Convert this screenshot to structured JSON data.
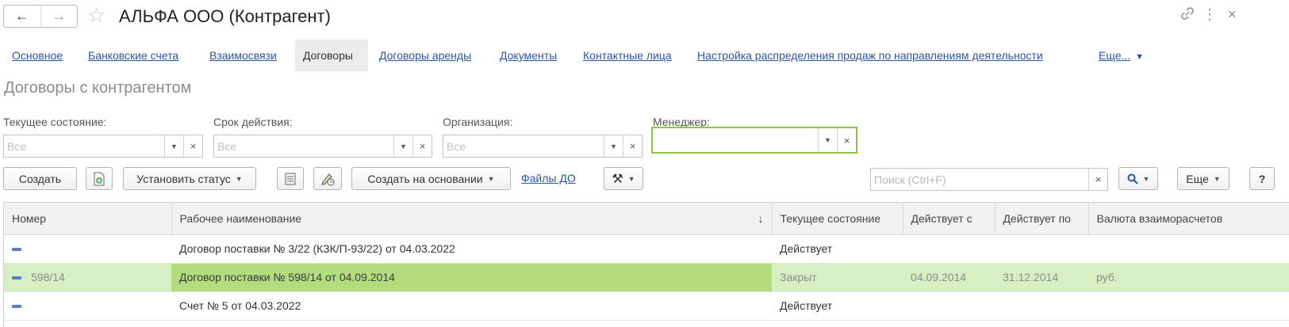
{
  "window": {
    "title": "АЛЬФА ООО (Контрагент)",
    "back_icon": "←",
    "forward_icon": "→",
    "star_icon": "☆",
    "link_icon": "🔗",
    "menu_icon": "⋮",
    "close_icon": "×"
  },
  "tabs": [
    {
      "label": "Основное"
    },
    {
      "label": "Банковские счета"
    },
    {
      "label": "Взаимосвязи"
    },
    {
      "label": "Договоры",
      "active": true
    },
    {
      "label": "Договоры аренды"
    },
    {
      "label": "Документы"
    },
    {
      "label": "Контактные лица"
    },
    {
      "label": "Настройка распределения продаж по направлениям деятельности"
    },
    {
      "label": "Еще..."
    }
  ],
  "section": {
    "title": "Договоры с контрагентом"
  },
  "filters": {
    "status": {
      "label": "Текущее состояние:",
      "placeholder": "Все",
      "value": ""
    },
    "term": {
      "label": "Срок действия:",
      "placeholder": "Все",
      "value": ""
    },
    "org": {
      "label": "Организация:",
      "placeholder": "Все",
      "value": ""
    },
    "manager": {
      "label": "Менеджер:",
      "placeholder": "",
      "value": ""
    },
    "dropdown_icon": "▼",
    "clear_icon": "×"
  },
  "toolbar": {
    "create": "Создать",
    "set_status": "Установить статус",
    "create_based": "Создать на основании",
    "files_link": "Файлы ДО",
    "search_placeholder": "Поиск (Ctrl+F)",
    "more": "Еще",
    "help": "?",
    "caret": "▼",
    "tools_icon": "⚒",
    "search_icon": "🔍"
  },
  "table": {
    "columns": [
      "Номер",
      "Рабочее наименование",
      "Текущее состояние",
      "Действует с",
      "Действует по",
      "Валюта взаиморасчетов"
    ],
    "sort_indicator": "↓",
    "rows": [
      {
        "number": "",
        "name": "Договор поставки № 3/22 (КЗК/П-93/22) от 04.03.2022",
        "status": "Действует",
        "from": "",
        "to": "",
        "currency": ""
      },
      {
        "number": "598/14",
        "name": "Договор поставки № 598/14 от 04.09.2014",
        "status": "Закрыт",
        "from": "04.09.2014",
        "to": "31.12.2014",
        "currency": "руб."
      },
      {
        "number": "",
        "name": "Счет № 5 от 04.03.2022",
        "status": "Действует",
        "from": "",
        "to": "",
        "currency": ""
      }
    ]
  },
  "colors": {
    "link": "#2b55a5",
    "selected_row": "#d7f0c3",
    "selected_cell": "#b1dd7d",
    "focus_border": "#8cc63f"
  }
}
